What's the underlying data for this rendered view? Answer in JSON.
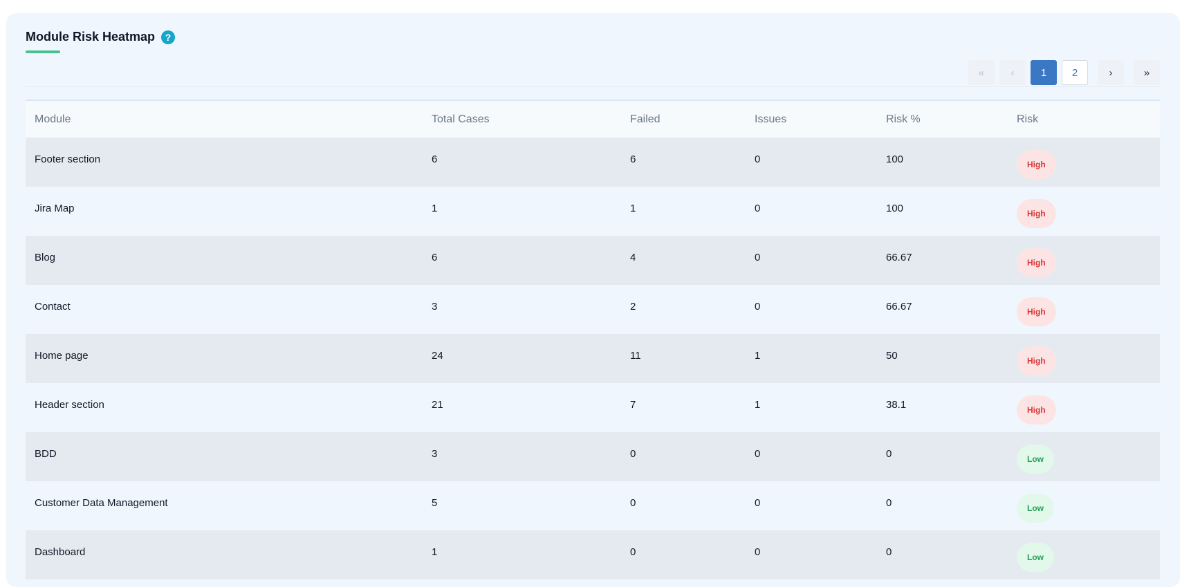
{
  "panel": {
    "title": "Module Risk Heatmap",
    "help_icon": "help-circle-icon"
  },
  "pagination": {
    "first": "«",
    "prev": "‹",
    "pages": [
      "1",
      "2"
    ],
    "current_page": "1",
    "next": "›",
    "last": "»"
  },
  "table": {
    "columns": [
      "Module",
      "Total Cases",
      "Failed",
      "Issues",
      "Risk %",
      "Risk"
    ],
    "rows": [
      {
        "module": "Footer section",
        "total": "6",
        "failed": "6",
        "issues": "0",
        "risk_pct": "100",
        "risk": "High"
      },
      {
        "module": "Jira Map",
        "total": "1",
        "failed": "1",
        "issues": "0",
        "risk_pct": "100",
        "risk": "High"
      },
      {
        "module": "Blog",
        "total": "6",
        "failed": "4",
        "issues": "0",
        "risk_pct": "66.67",
        "risk": "High"
      },
      {
        "module": "Contact",
        "total": "3",
        "failed": "2",
        "issues": "0",
        "risk_pct": "66.67",
        "risk": "High"
      },
      {
        "module": "Home page",
        "total": "24",
        "failed": "11",
        "issues": "1",
        "risk_pct": "50",
        "risk": "High"
      },
      {
        "module": "Header section",
        "total": "21",
        "failed": "7",
        "issues": "1",
        "risk_pct": "38.1",
        "risk": "High"
      },
      {
        "module": "BDD",
        "total": "3",
        "failed": "0",
        "issues": "0",
        "risk_pct": "0",
        "risk": "Low"
      },
      {
        "module": "Customer Data Management",
        "total": "5",
        "failed": "0",
        "issues": "0",
        "risk_pct": "0",
        "risk": "Low"
      },
      {
        "module": "Dashboard",
        "total": "1",
        "failed": "0",
        "issues": "0",
        "risk_pct": "0",
        "risk": "Low"
      }
    ]
  },
  "colors": {
    "high_text": "#d93838",
    "high_bg": "#fde4e4",
    "low_text": "#27a05a",
    "low_bg": "#e1f8ea",
    "accent": "#3b78c4"
  }
}
